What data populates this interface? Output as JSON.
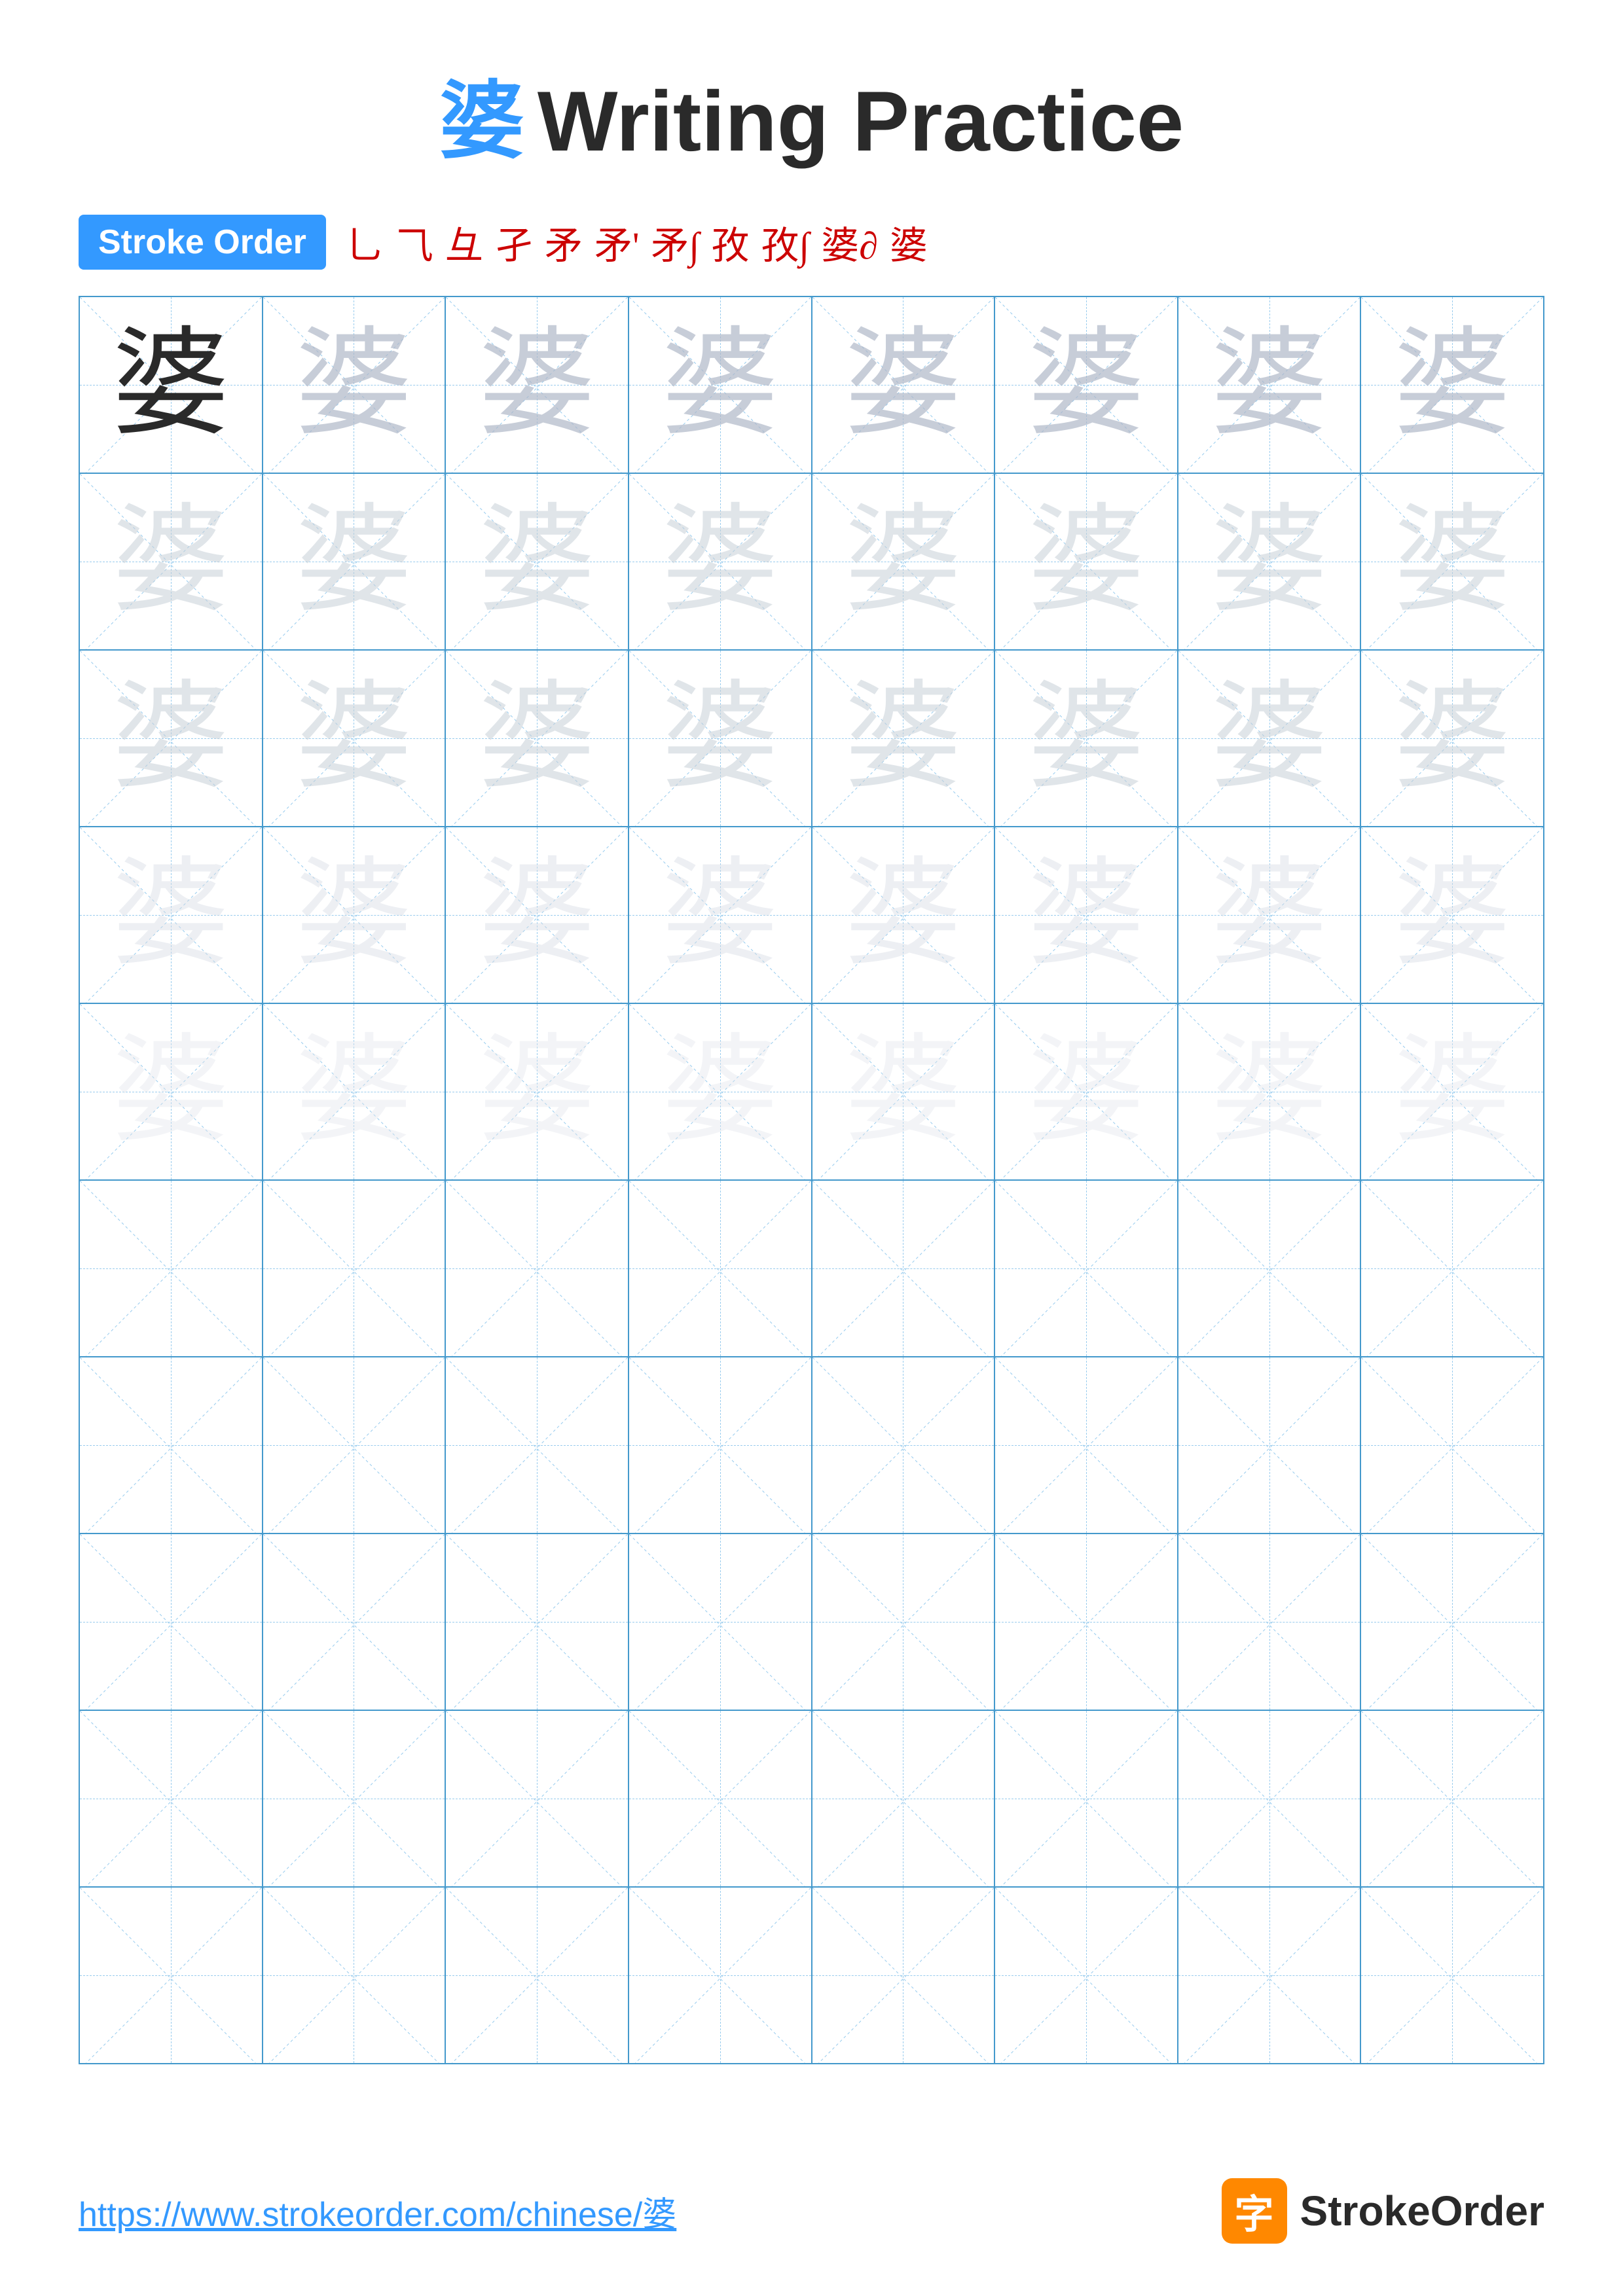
{
  "title": {
    "char": "婆",
    "label": "Writing Practice"
  },
  "stroke_order": {
    "badge_label": "Stroke Order",
    "sequence": [
      "⺃",
      "⺃",
      "彑",
      "孑",
      "矛",
      "矛'",
      "矛∫",
      "孜",
      "孜∫",
      "婆∂",
      "婆"
    ]
  },
  "character": "婆",
  "grid": {
    "rows": 10,
    "cols": 8,
    "practice_rows": 5,
    "empty_rows": 5
  },
  "footer": {
    "url": "https://www.strokeorder.com/chinese/婆",
    "logo_char": "字",
    "brand": "StrokeOrder"
  }
}
